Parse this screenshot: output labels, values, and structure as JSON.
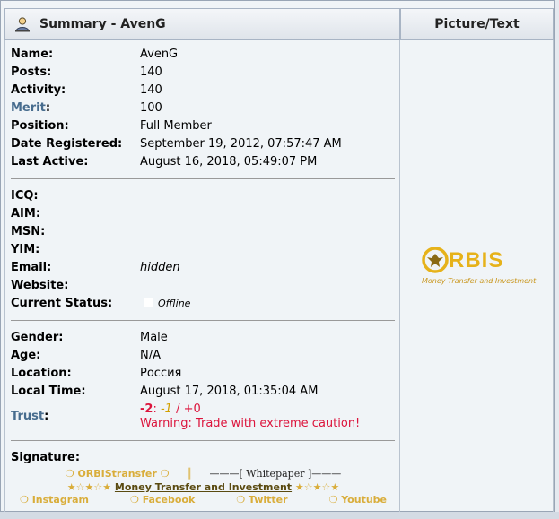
{
  "header": {
    "title": "Summary - AvenG",
    "right_title": "Picture/Text"
  },
  "profile": {
    "name_label": "Name:",
    "name": "AvenG",
    "posts_label": "Posts:",
    "posts": "140",
    "activity_label": "Activity:",
    "activity": "140",
    "merit_label": "Merit",
    "merit": "100",
    "position_label": "Position:",
    "position": "Full Member",
    "registered_label": "Date Registered:",
    "registered": "September 19, 2012, 07:57:47 AM",
    "last_active_label": "Last Active:",
    "last_active": "August 16, 2018, 05:49:07 PM"
  },
  "contact": {
    "icq_label": "ICQ:",
    "aim_label": "AIM:",
    "msn_label": "MSN:",
    "yim_label": "YIM:",
    "email_label": "Email:",
    "email": "hidden",
    "website_label": "Website:",
    "status_label": "Current Status:",
    "status": "Offline"
  },
  "personal": {
    "gender_label": "Gender:",
    "gender": "Male",
    "age_label": "Age:",
    "age": "N/A",
    "location_label": "Location:",
    "location": "Россия",
    "local_time_label": "Local Time:",
    "local_time": "August 17, 2018, 01:35:04 AM",
    "trust_label": "Trust",
    "trust_neg": "-2",
    "trust_mid": "-1",
    "trust_pos": "+0",
    "trust_warning": "Warning: Trade with extreme caution!"
  },
  "signature": {
    "label": "Signature:",
    "line1_brand": "ORBIStransfer",
    "line1_whitepaper": "———[ Whitepaper ]———",
    "line2_text": "Money Transfer and Investment",
    "links": [
      "Instagram",
      "Facebook",
      "Twitter",
      "Youtube"
    ]
  },
  "picture": {
    "logo_word": "RBIS",
    "logo_sub": "Money Transfer and Investment"
  },
  "colors": {
    "accent_blue": "#476c8e",
    "warning_red": "#dc143c",
    "gold": "#e6b21a"
  }
}
